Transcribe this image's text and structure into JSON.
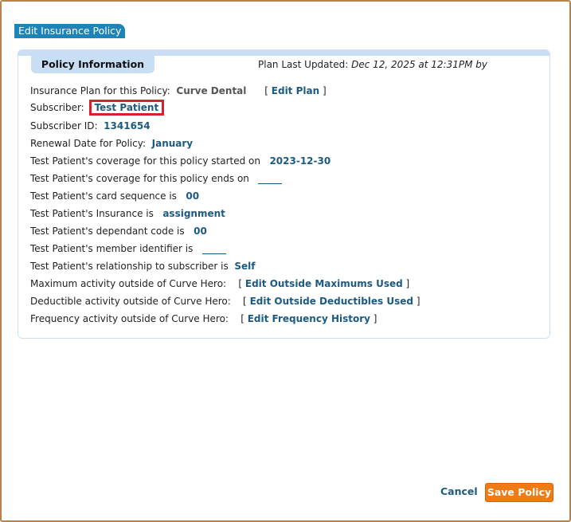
{
  "dialog": {
    "title": "Edit Insurance Policy"
  },
  "panel": {
    "tab_label": "Policy Information",
    "plan_updated_label": "Plan Last Updated:",
    "plan_updated_value": "Dec 12, 2025 at 12:31PM by"
  },
  "rows": {
    "plan": {
      "label": "Insurance Plan for this Policy:",
      "value": "Curve Dental",
      "link": "Edit Plan"
    },
    "subscriber": {
      "label": "Subscriber:",
      "value": "Test Patient"
    },
    "subscriber_id": {
      "label": "Subscriber ID:",
      "value": "1341654"
    },
    "renewal": {
      "label": "Renewal Date for Policy:",
      "value": "January"
    },
    "coverage_start": {
      "label": "Test Patient's coverage for this policy started on",
      "value": "2023-12-30"
    },
    "coverage_end": {
      "label": "Test Patient's coverage for this policy ends on"
    },
    "card_sequence": {
      "label": "Test Patient's card sequence is",
      "value": "00"
    },
    "insurance": {
      "label": "Test Patient's Insurance is",
      "value": "assignment"
    },
    "dependant_code": {
      "label": "Test Patient's dependant code is",
      "value": "00"
    },
    "member_id": {
      "label": "Test Patient's member identifier is"
    },
    "relationship": {
      "label": "Test Patient's relationship to subscriber is",
      "value": "Self"
    },
    "max_activity": {
      "label": "Maximum activity outside of Curve Hero:",
      "link": "Edit Outside Maximums Used"
    },
    "deductible_activity": {
      "label": "Deductible activity outside of Curve Hero:",
      "link": "Edit Outside Deductibles Used"
    },
    "frequency_activity": {
      "label": "Frequency activity outside of Curve Hero:",
      "link": "Edit Frequency History"
    }
  },
  "footer": {
    "cancel_label": "Cancel",
    "save_label": "Save Policy"
  },
  "colors": {
    "accent": "#1c84b8",
    "save": "#f07a14",
    "highlight": "#d8202a",
    "link": "#1b5a82"
  }
}
